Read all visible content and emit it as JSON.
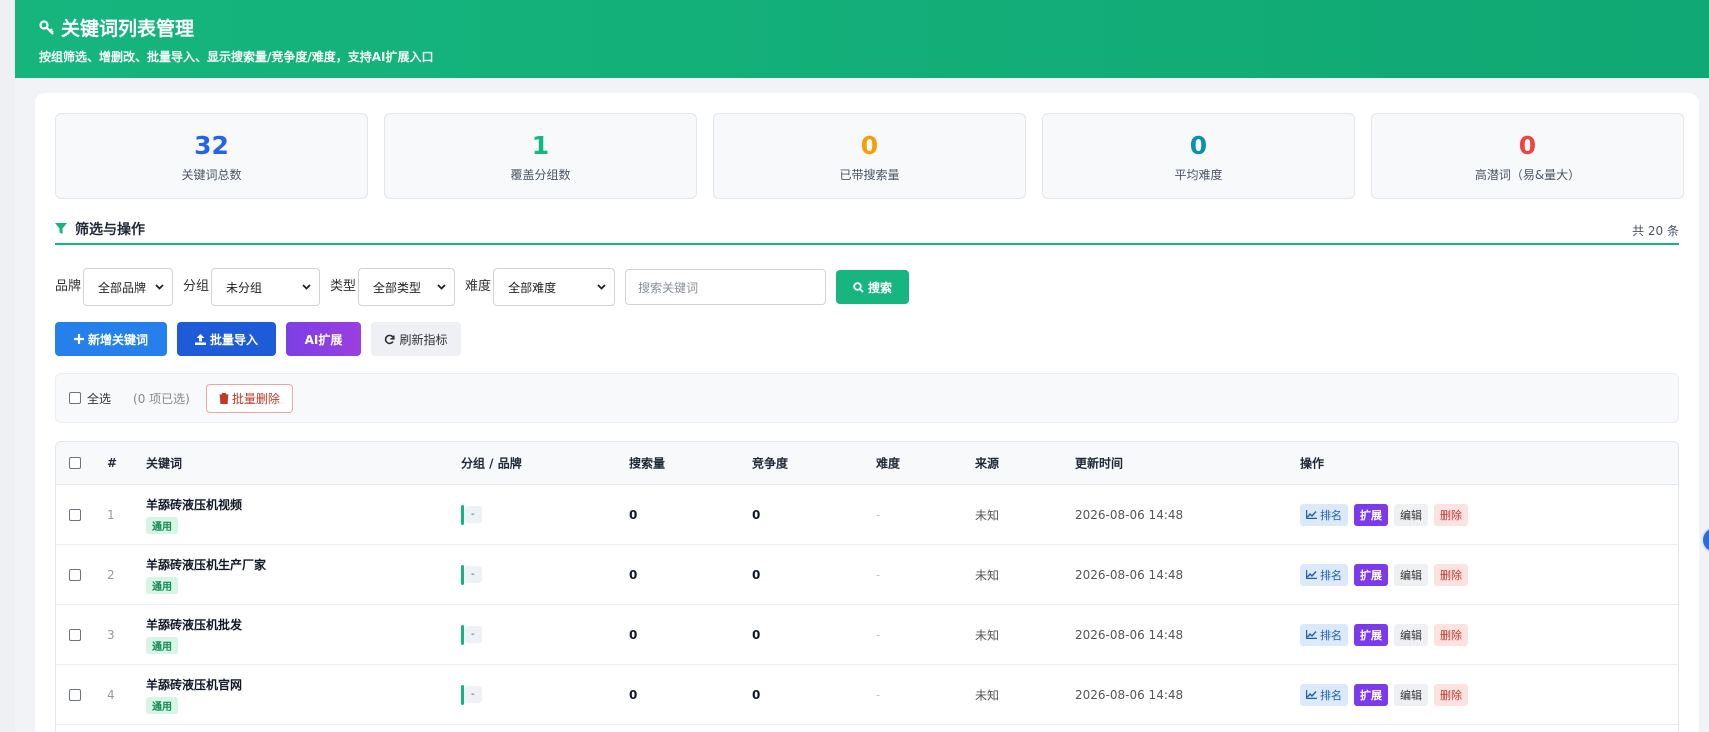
{
  "header": {
    "title": "关键词列表管理",
    "subtitle": "按组筛选、增删改、批量导入、显示搜索量/竞争度/难度，支持AI扩展入口"
  },
  "stats": [
    {
      "value": "32",
      "label": "关键词总数",
      "color": "#2563eb"
    },
    {
      "value": "1",
      "label": "覆盖分组数",
      "color": "#10b981"
    },
    {
      "value": "0",
      "label": "已带搜索量",
      "color": "#f59e0b"
    },
    {
      "value": "0",
      "label": "平均难度",
      "color": "#0891b2"
    },
    {
      "value": "0",
      "label": "高潜词（易&量大）",
      "color": "#ef4444"
    }
  ],
  "section": {
    "title": "筛选与操作",
    "count": "共 20 条"
  },
  "filters": {
    "brand": {
      "label": "品牌",
      "value": "全部品牌"
    },
    "group": {
      "label": "分组",
      "value": "未分组"
    },
    "type": {
      "label": "类型",
      "value": "全部类型"
    },
    "difficulty": {
      "label": "难度",
      "value": "全部难度"
    },
    "search_placeholder": "搜索关键词",
    "search_button": "搜索"
  },
  "actions": {
    "add": "新增关键词",
    "import": "批量导入",
    "ai": "AI扩展",
    "refresh": "刷新指标"
  },
  "bulk": {
    "select_all": "全选",
    "selected": "(0 项已选)",
    "delete": "批量删除"
  },
  "table": {
    "headers": {
      "idx": "#",
      "keyword": "关键词",
      "group": "分组 / 品牌",
      "volume": "搜索量",
      "competition": "竞争度",
      "difficulty": "难度",
      "source": "来源",
      "updated": "更新时间",
      "ops": "操作"
    },
    "ops": {
      "rank": "排名",
      "expand": "扩展",
      "edit": "编辑",
      "delete": "删除"
    },
    "rows": [
      {
        "idx": "1",
        "keyword": "羊舔砖液压机视频",
        "tag": "通用",
        "group": "-",
        "volume": "0",
        "competition": "0",
        "difficulty": "-",
        "source": "未知",
        "updated": "2026-08-06 14:48"
      },
      {
        "idx": "2",
        "keyword": "羊舔砖液压机生产厂家",
        "tag": "通用",
        "group": "-",
        "volume": "0",
        "competition": "0",
        "difficulty": "-",
        "source": "未知",
        "updated": "2026-08-06 14:48"
      },
      {
        "idx": "3",
        "keyword": "羊舔砖液压机批发",
        "tag": "通用",
        "group": "-",
        "volume": "0",
        "competition": "0",
        "difficulty": "-",
        "source": "未知",
        "updated": "2026-08-06 14:48"
      },
      {
        "idx": "4",
        "keyword": "羊舔砖液压机官网",
        "tag": "通用",
        "group": "-",
        "volume": "0",
        "competition": "0",
        "difficulty": "-",
        "source": "未知",
        "updated": "2026-08-06 14:48"
      }
    ]
  }
}
